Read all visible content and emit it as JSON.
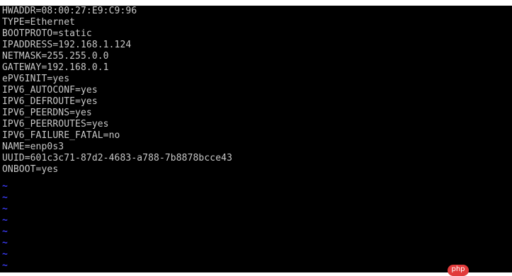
{
  "terminal": {
    "lines": [
      "HWADDR=08:00:27:E9:C9:96",
      "TYPE=Ethernet",
      "BOOTPROTO=static",
      "IPADDRESS=192.168.1.124",
      "NETMASK=255.255.0.0",
      "GATEWAY=192.168.0.1",
      "ePV6INIT=yes",
      "IPV6_AUTOCONF=yes",
      "IPV6_DEFROUTE=yes",
      "IPV6_PEERDNS=yes",
      "IPV6_PEERROUTES=yes",
      "IPV6_FAILURE_FATAL=no",
      "NAME=enp0s3",
      "UUID=601c3c71-87d2-4683-a788-7b8878bcce43",
      "ONBOOT=yes"
    ],
    "empty_line_marker": "~",
    "marker_color": "#3a3af0",
    "text_color": "#c8c8c8",
    "background_color": "#000000"
  },
  "watermark": {
    "label": "php",
    "color": "#e23b3b"
  }
}
